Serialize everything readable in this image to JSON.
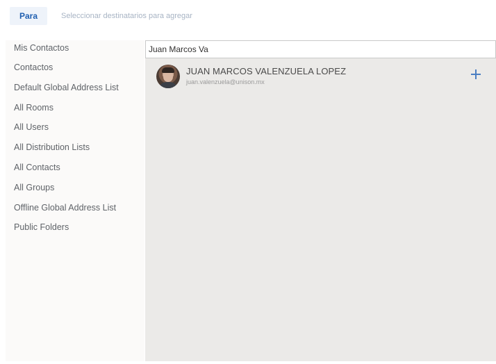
{
  "header": {
    "to_label": "Para",
    "to_hint": "Seleccionar destinatarios para agregar"
  },
  "sidebar": {
    "items": [
      {
        "label": "Mis Contactos"
      },
      {
        "label": "Contactos"
      },
      {
        "label": "Default Global Address List"
      },
      {
        "label": "All Rooms"
      },
      {
        "label": "All Users"
      },
      {
        "label": "All Distribution Lists"
      },
      {
        "label": "All Contacts"
      },
      {
        "label": "All Groups"
      },
      {
        "label": "Offline Global Address List"
      },
      {
        "label": "Public Folders"
      }
    ]
  },
  "search": {
    "value": "Juan Marcos Va"
  },
  "results": [
    {
      "name": "JUAN MARCOS VALENZUELA LOPEZ",
      "email": "juan.valenzuela@unison.mx",
      "avatar_icon": "person-photo",
      "action_icon": "plus-icon"
    }
  ],
  "colors": {
    "accent": "#1f5fb0",
    "add_icon": "#4a7ec2",
    "results_background": "#ebeae8",
    "sidebar_background": "#fbfaf9"
  }
}
